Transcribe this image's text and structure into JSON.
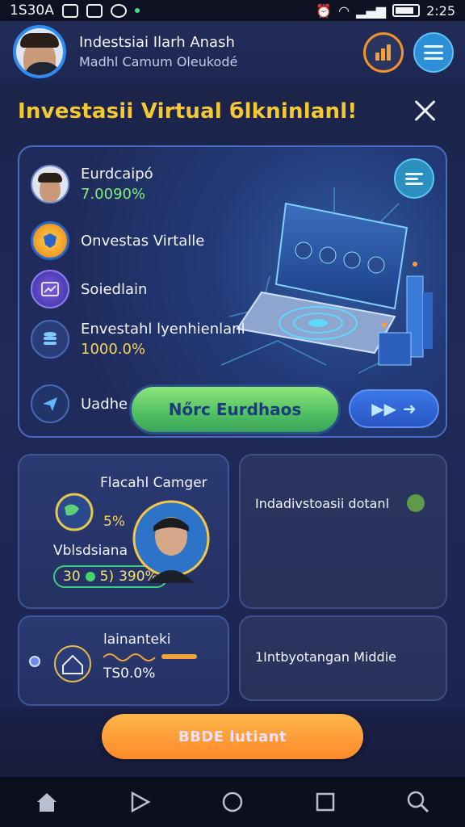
{
  "status_bar": {
    "left_text": "1S30A",
    "time": "2:25"
  },
  "header": {
    "title": "Indestsiai Ilarh Anash",
    "subtitle": "Madhl Camum Oleukodé"
  },
  "page_title": "Investasii Virtual бlkninlanl!",
  "hero": {
    "items": [
      {
        "label": "Eurdcaipó",
        "value": "7.0090%",
        "icon": "avatar-icon"
      },
      {
        "label": "Onvestas Virtalle",
        "icon": "shield-coin-icon"
      },
      {
        "label": "Soiedlain",
        "icon": "chart-window-icon"
      },
      {
        "label": "Envestahl lyenhienlanl",
        "value": "1000.0%",
        "icon": "database-icon"
      },
      {
        "label": "Uadhe",
        "icon": "paper-plane-icon"
      }
    ],
    "cta_label": "Nőrc Eurdhaos"
  },
  "cards": {
    "card1": {
      "title": "Flacahl Camger",
      "pct": "5%",
      "label": "Vblsdsiana",
      "pill_left": "30",
      "pill_mid": "5)",
      "pill_right": "390%"
    },
    "card2": {
      "title": "Indadivstoasii dotanl"
    },
    "card3": {
      "title": "lainanteki",
      "value": "TS0.0%"
    },
    "card4": {
      "title": "1Intbyotangan Middie"
    }
  },
  "bottom_button": "BBDE lutiant",
  "colors": {
    "accent_gold": "#f6c832",
    "accent_green": "#4fbf62",
    "accent_orange": "#ff8a2a",
    "background": "#1f2853"
  }
}
